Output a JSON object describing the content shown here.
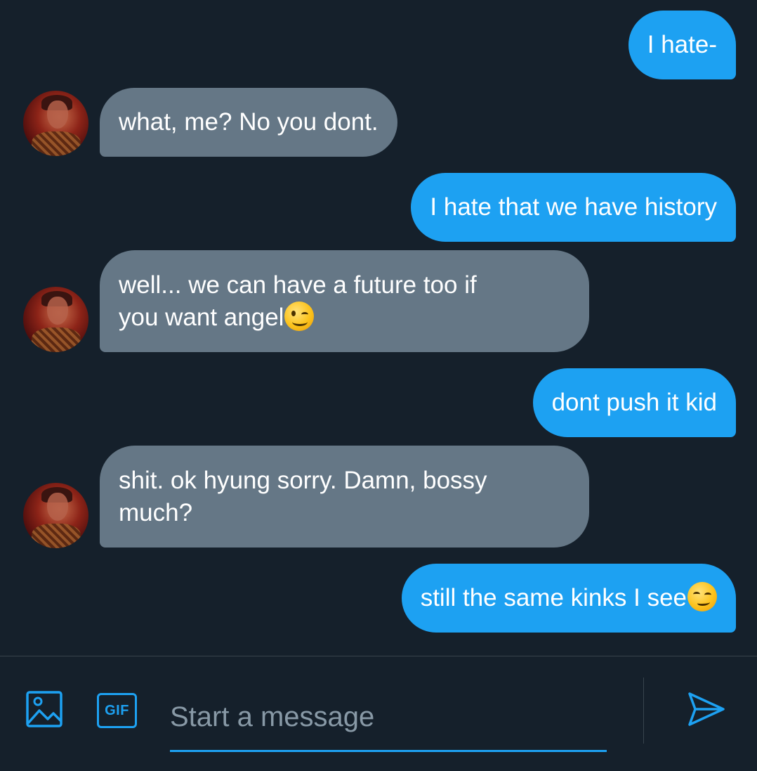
{
  "conversation": {
    "messages": [
      {
        "direction": "outgoing",
        "text": "I hate-"
      },
      {
        "direction": "incoming",
        "text": "what, me? No you dont."
      },
      {
        "direction": "outgoing",
        "text": "I hate that we have history"
      },
      {
        "direction": "incoming",
        "text": "well... we can have a future too if\nyou want angel",
        "emoji": "winking-face"
      },
      {
        "direction": "outgoing",
        "text": "dont push it kid"
      },
      {
        "direction": "incoming",
        "text": "shit. ok hyung sorry. Damn, bossy\nmuch?"
      },
      {
        "direction": "outgoing",
        "text": "still the same kinks I see",
        "emoji": "smirking-face"
      }
    ]
  },
  "composer": {
    "gif_label": "GIF",
    "placeholder": "Start a message",
    "icons": {
      "media": "image-icon",
      "send": "send-icon"
    }
  },
  "colors": {
    "background": "#15202b",
    "outgoing_bubble": "#1da1f2",
    "incoming_bubble": "#657786",
    "accent": "#1da1f2",
    "placeholder": "#8899a6"
  }
}
